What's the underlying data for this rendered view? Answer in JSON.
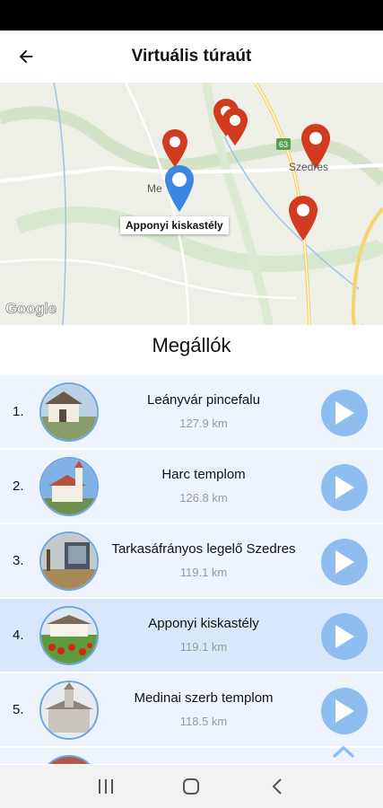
{
  "app_bar": {
    "title": "Virtuális túraút",
    "back_icon": "arrow-left-icon"
  },
  "map": {
    "tooltip": "Apponyi kiskastély",
    "town_label_1": "Szedres",
    "town_label_2": "Me",
    "route_number": "63",
    "attribution": "Google",
    "marker_color": "#d23b1f",
    "current_marker_color": "#3b86e0"
  },
  "section_title": "Megállók",
  "stops": [
    {
      "num": "1.",
      "name": "Leányvár pincefalu",
      "distance": "127.9 km",
      "selected": false
    },
    {
      "num": "2.",
      "name": "Harc templom",
      "distance": "126.8 km",
      "selected": false
    },
    {
      "num": "3.",
      "name": "Tarkasáfrányos legelő Szedres",
      "distance": "119.1 km",
      "selected": false
    },
    {
      "num": "4.",
      "name": "Apponyi kiskastély",
      "distance": "119.1 km",
      "selected": true
    },
    {
      "num": "5.",
      "name": "Medinai szerb templom",
      "distance": "118.5 km",
      "selected": false
    }
  ],
  "nav": {
    "recents_icon": "recents-icon",
    "home_icon": "home-icon",
    "back_icon": "back-chevron-icon"
  },
  "colors": {
    "accent": "#8fbdf0",
    "row_bg": "#edf4fd",
    "row_selected_bg": "#d8e7fb"
  }
}
